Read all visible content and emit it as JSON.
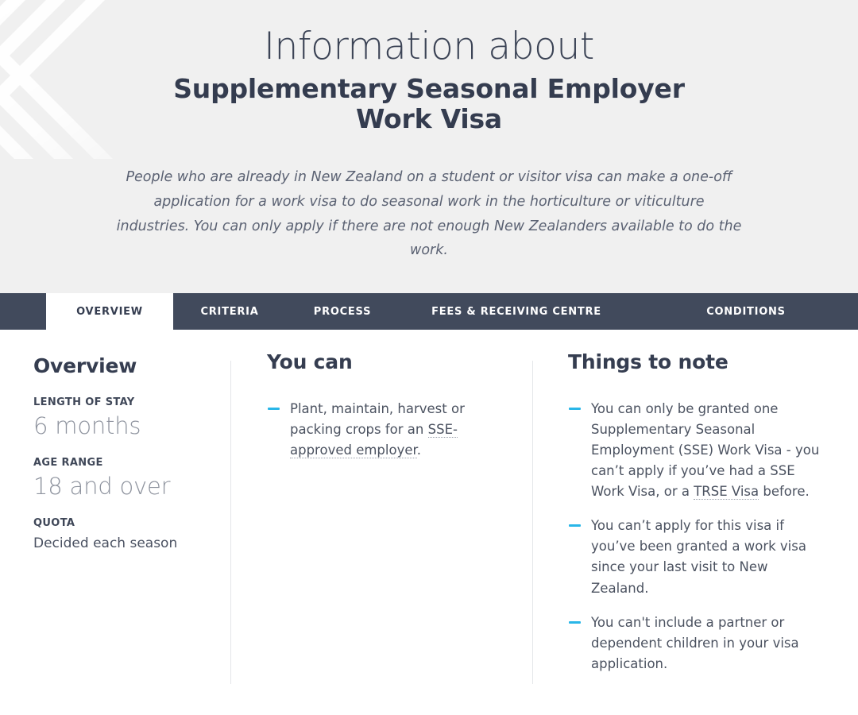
{
  "header": {
    "eyebrow": "Information about",
    "title": "Supplementary Seasonal Employer Work Visa",
    "lede": "People who are already in New Zealand on a student or visitor visa can make a one-off application for a work visa to do seasonal work in the horticulture or viticulture industries. You can only apply if there are not enough New Zealanders available to do the work.",
    "background_color": "#f0f0f0",
    "title_color": "#343c4f"
  },
  "tabs": {
    "active_index": 0,
    "bar_color": "#414a5c",
    "active_bg": "#ffffff",
    "items": [
      {
        "label": "OVERVIEW"
      },
      {
        "label": "CRITERIA"
      },
      {
        "label": "PROCESS"
      },
      {
        "label": "FEES & RECEIVING CENTRE"
      },
      {
        "label": "CONDITIONS"
      }
    ]
  },
  "overview": {
    "heading": "Overview",
    "facts": [
      {
        "label": "LENGTH OF STAY",
        "value": "6 months",
        "size": "big"
      },
      {
        "label": "AGE RANGE",
        "value": "18 and over",
        "size": "big"
      },
      {
        "label": "QUOTA",
        "value": "Decided each season",
        "size": "small"
      }
    ]
  },
  "you_can": {
    "heading": "You can",
    "bullets": [
      {
        "text_before": "Plant, maintain, harvest or packing crops for an ",
        "abbr": "SSE-approved employer",
        "text_after": "."
      }
    ]
  },
  "things_to_note": {
    "heading": "Things to note",
    "bullets": [
      {
        "text_before": "You can only be granted one Supplementary Seasonal Employment (SSE) Work Visa - you can’t apply if you’ve had a SSE Work Visa, or a ",
        "abbr": "TRSE Visa",
        "text_after": " before."
      },
      {
        "text_before": "You can’t apply for this visa if you’ve been granted a work visa since your last visit to New Zealand.",
        "abbr": "",
        "text_after": ""
      },
      {
        "text_before": "You can't include a partner or dependent children in your visa application.",
        "abbr": "",
        "text_after": ""
      }
    ]
  },
  "accent": {
    "bullet_dash_color": "#29b6e8",
    "divider_color": "#e4e6e9"
  }
}
